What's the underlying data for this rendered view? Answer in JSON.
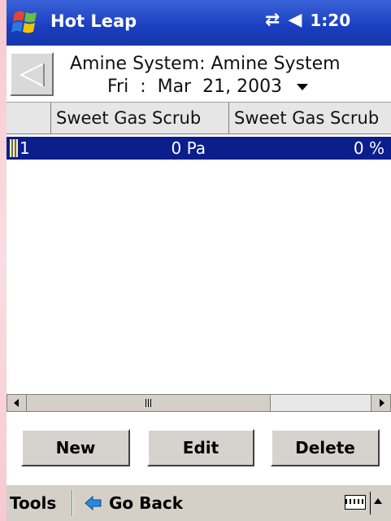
{
  "titlebar": {
    "app_title": "Hot Leap",
    "time": "1:20",
    "connectivity_icon": "sync-arrows-icon",
    "volume_icon": "speaker-icon"
  },
  "header": {
    "system_title": "Amine System: Amine System",
    "date_label": "Fri  :  Mar  21, 2003"
  },
  "grid": {
    "columns": [
      "",
      "Sweet Gas Scrub",
      "Sweet Gas Scrub"
    ],
    "rows": [
      {
        "index": "1",
        "value1": "0 Pa",
        "value2": "0 %"
      }
    ],
    "selected_row_color": "#0a1e8c"
  },
  "scrollbar": {
    "grip": "III"
  },
  "actions": {
    "new_label": "New",
    "edit_label": "Edit",
    "delete_label": "Delete"
  },
  "menubar": {
    "tools_label": "Tools",
    "goback_label": "Go Back"
  }
}
